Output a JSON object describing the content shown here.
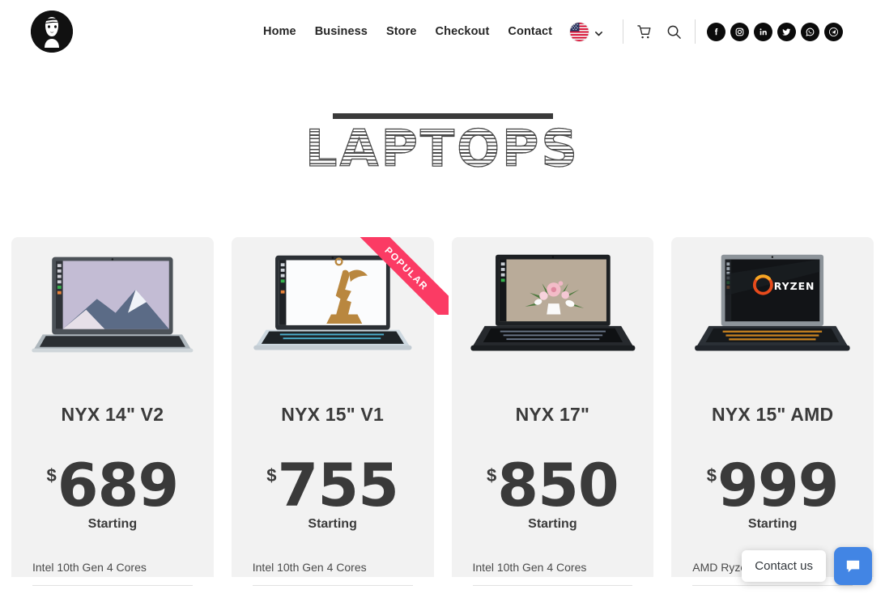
{
  "header": {
    "logo_icon": "woman-face-logo-icon",
    "nav": [
      {
        "label": "Home"
      },
      {
        "label": "Business"
      },
      {
        "label": "Store"
      },
      {
        "label": "Checkout"
      },
      {
        "label": "Contact"
      }
    ],
    "language": {
      "flag": "us-flag-icon",
      "chevron": "chevron-down-icon"
    },
    "utilities": [
      {
        "name": "cart-icon"
      },
      {
        "name": "search-icon"
      }
    ],
    "social": [
      {
        "name": "facebook-icon"
      },
      {
        "name": "instagram-icon"
      },
      {
        "name": "linkedin-icon"
      },
      {
        "name": "twitter-icon"
      },
      {
        "name": "whatsapp-icon"
      },
      {
        "name": "telegram-icon"
      }
    ]
  },
  "page": {
    "title": "LAPTOPS"
  },
  "colors": {
    "ribbon": "#fb3b64",
    "card_bg": "#f2f2f2",
    "text": "#3a3a3a",
    "chat_button": "#4285e4"
  },
  "products": [
    {
      "title": "NYX 14\" V2",
      "currency": "$",
      "price": "689",
      "price_note": "Starting",
      "spec": "Intel 10th Gen 4 Cores",
      "badge": null,
      "image_alt": "nyx-14-v2-laptop"
    },
    {
      "title": "NYX 15\" V1",
      "currency": "$",
      "price": "755",
      "price_note": "Starting",
      "spec": "Intel 10th Gen 4 Cores",
      "badge": "POPULAR",
      "image_alt": "nyx-15-v1-laptop"
    },
    {
      "title": "NYX 17\"",
      "currency": "$",
      "price": "850",
      "price_note": "Starting",
      "spec": "Intel 10th Gen 4 Cores",
      "badge": null,
      "image_alt": "nyx-17-laptop"
    },
    {
      "title": "NYX 15\" AMD",
      "currency": "$",
      "price": "999",
      "price_note": "Starting",
      "spec": "AMD Ryzen",
      "badge": null,
      "image_alt": "nyx-15-amd-laptop"
    }
  ],
  "chat": {
    "tooltip": "Contact us",
    "button_icon": "chat-bubble-icon"
  }
}
